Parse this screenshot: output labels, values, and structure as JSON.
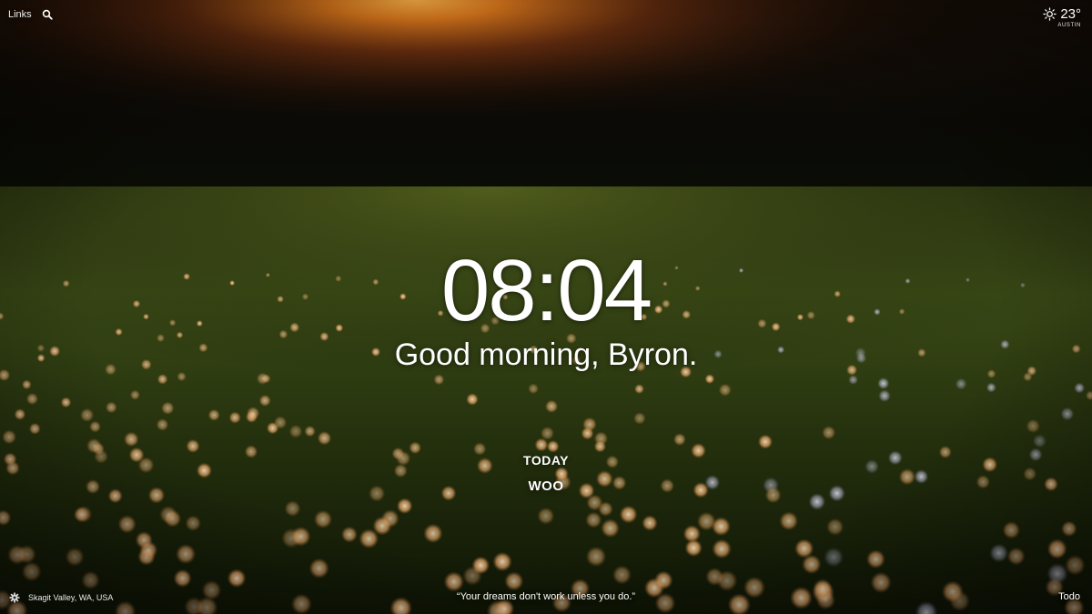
{
  "top_left": {
    "links_label": "Links",
    "search_icon": "search-icon"
  },
  "weather": {
    "icon": "sun-icon",
    "temperature": "23°",
    "location": "AUSTIN"
  },
  "center": {
    "time": "08:04",
    "greeting": "Good morning, Byron.",
    "focus_title": "TODAY",
    "focus_task": "WOO"
  },
  "bottom": {
    "settings_icon": "gear-icon",
    "photo_location": "Skagit Valley, WA, USA",
    "quote": "“Your dreams don't work unless you do.”",
    "todo_label": "Todo"
  },
  "colors": {
    "text": "#ffffff",
    "sky_glow": "#f0a030",
    "grass": "#2e3a12"
  }
}
